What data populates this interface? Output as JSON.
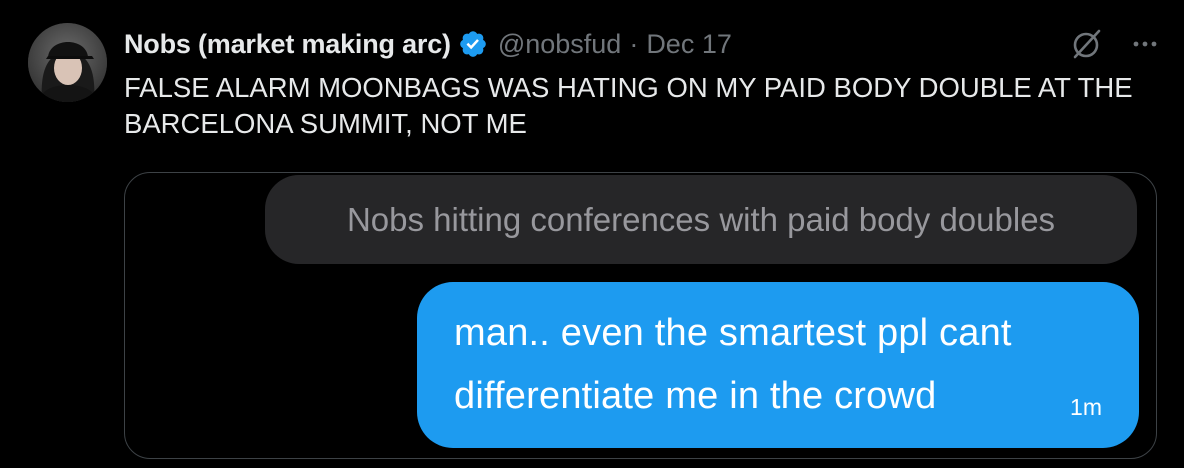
{
  "tweet": {
    "display_name": "Nobs (market making arc)",
    "handle": "@nobsfud",
    "separator": "·",
    "date": "Dec 17",
    "text": "FALSE ALARM MOONBAGS WAS HATING ON MY PAID BODY DOUBLE AT THE BARCELONA SUMMIT, NOT ME"
  },
  "media": {
    "received_message": "Nobs hitting conferences with paid body doubles",
    "sent_message_line1": "man.. even the smartest ppl cant",
    "sent_message_line2": "differentiate me in the crowd",
    "sent_time": "1m"
  },
  "icons": {
    "verified": "verified-badge-icon",
    "grok": "grok-icon",
    "more": "more-options-icon"
  },
  "colors": {
    "background": "#000000",
    "primary_text": "#e7e9ea",
    "secondary_text": "#71767b",
    "accent": "#1d9bf0",
    "received_bubble": "#262628"
  }
}
